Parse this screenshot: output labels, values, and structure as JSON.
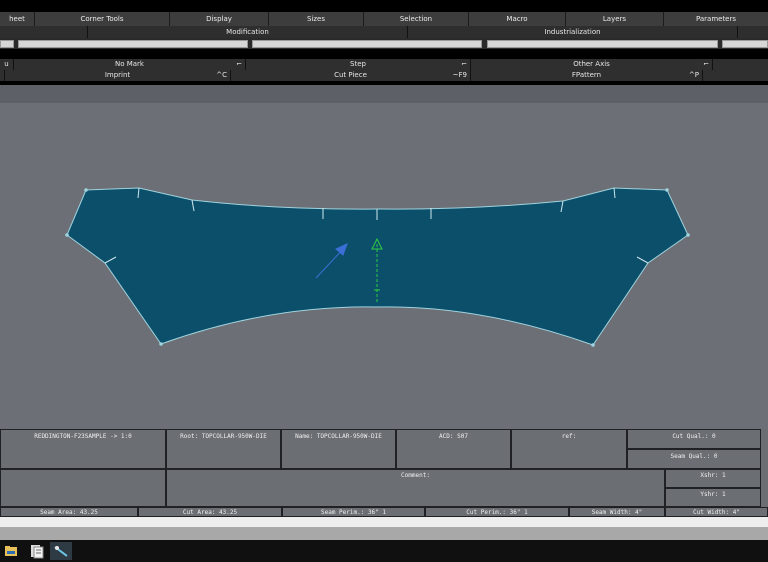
{
  "menubar": {
    "items": [
      "heet",
      "Corner Tools",
      "Display",
      "Sizes",
      "Selection",
      "Macro",
      "Layers",
      "Parameters"
    ]
  },
  "groups": {
    "modification": "Modification",
    "industrialization": "Industrialization"
  },
  "toolrow1": {
    "left_label": "u",
    "no_mark": "No Mark",
    "step": "Step",
    "other_axis": "Other Axis",
    "corner_glyph": "⌐"
  },
  "toolrow2": {
    "imprint": "Imprint",
    "imprint_shortcut": "^C",
    "cut_piece": "Cut Piece",
    "cut_piece_shortcut": "~F9",
    "fpattern": "FPattern",
    "fpattern_shortcut": "^P"
  },
  "info": {
    "model": "REDDINGTON-F23SAMPLE -> 1:0",
    "root": "Root: TOPCOLLAR-950W-DIE",
    "name": "Name: TOPCOLLAR-950W-DIE",
    "acd": "ACD: S07",
    "ref": "ref:",
    "cut_qual": "Cut Qual.: 0",
    "seam_qual": "Seam Qual.: 0",
    "comment": "Comment:",
    "xshr": "Xshr: 1",
    "yshr": "Yshr: 1"
  },
  "status": {
    "seam_area": "Seam Area: 43.25",
    "cut_area": "Cut Area: 43.25",
    "seam_perim": "Seam Perim.: 36\" 1",
    "cut_perim": "Cut Perim.: 36\" 1",
    "seam_width": "Seam Width: 4\"",
    "cut_width": "Cut Width: 4\""
  },
  "colors": {
    "piece_fill": "#0b4f6a",
    "piece_outline": "#9fd3df",
    "grain_line": "#2ecc40",
    "workspace": "#6c6f75"
  },
  "taskbar": {
    "icons": [
      "file-explorer-icon",
      "documents-icon",
      "pattern-app-icon"
    ]
  }
}
